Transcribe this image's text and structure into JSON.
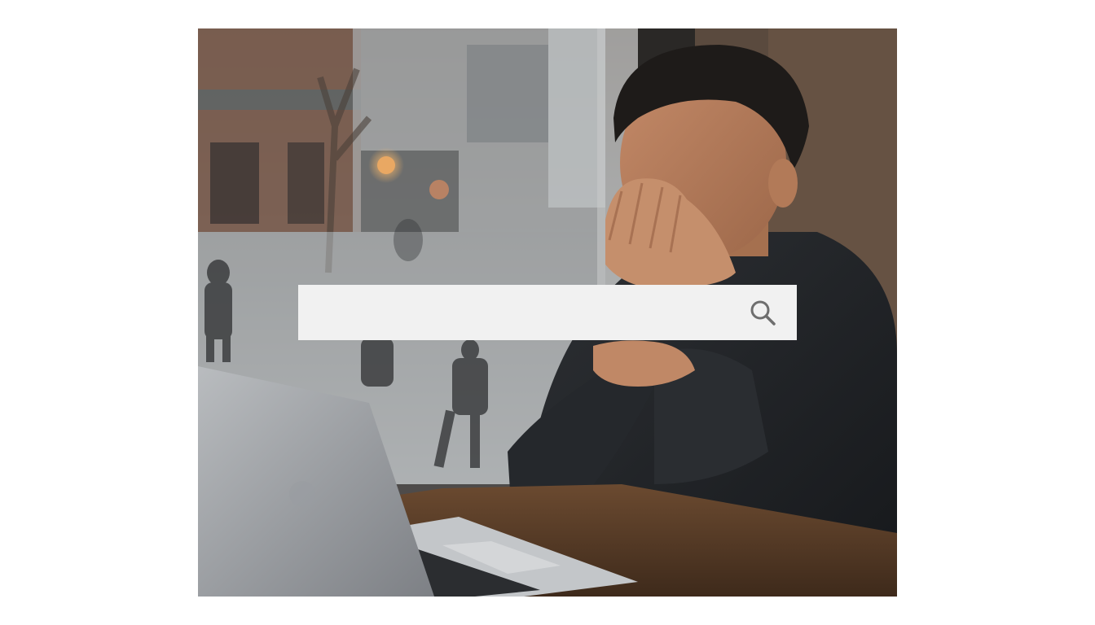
{
  "search": {
    "value": "",
    "placeholder": ""
  },
  "icons": {
    "search_button": "magnifying-glass"
  },
  "colors": {
    "page_background": "#ffffff",
    "search_bar_background": "#f1f1f1",
    "search_icon": "#6e6e6e"
  }
}
